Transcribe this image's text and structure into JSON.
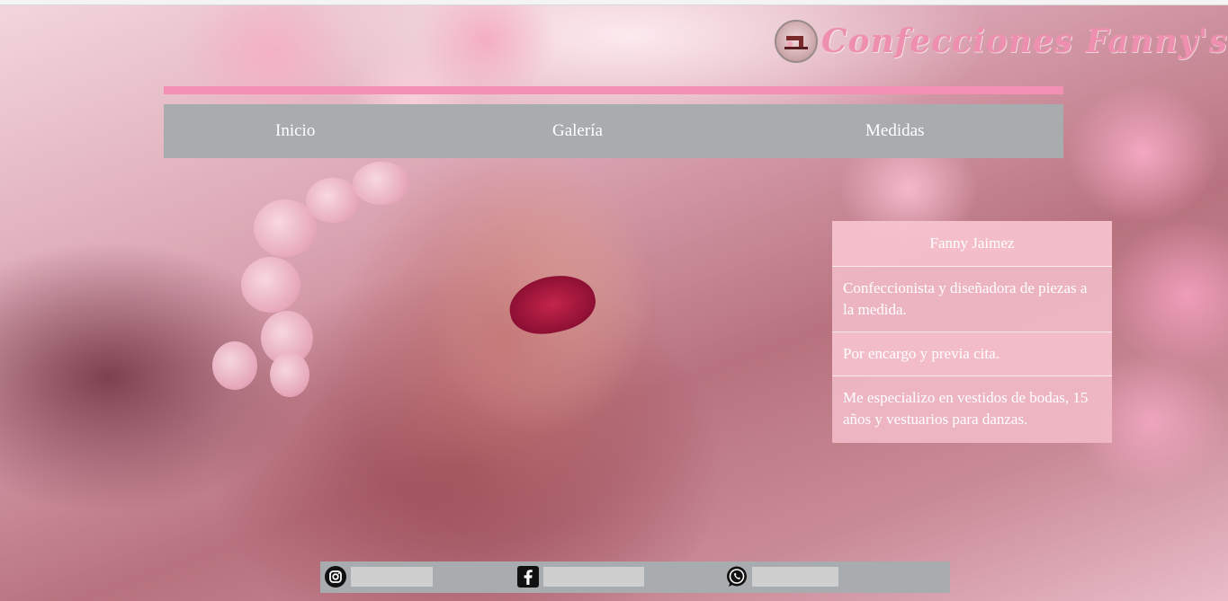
{
  "header": {
    "brand": "Confecciones Fanny's"
  },
  "nav": {
    "items": [
      "Inicio",
      "Galería",
      "Medidas"
    ]
  },
  "panel": {
    "title": "Fanny Jaimez",
    "rows": [
      "Confeccionista y diseñadora de piezas a la medida.",
      "Por encargo y previa cita.",
      "Me especializo en vestidos de bodas, 15 años y vestuarios para danzas."
    ]
  },
  "footer": {
    "links": [
      {
        "icon": "instagram-icon",
        "label": ""
      },
      {
        "icon": "facebook-icon",
        "label": ""
      },
      {
        "icon": "whatsapp-icon",
        "label": ""
      }
    ]
  },
  "colors": {
    "accent_pink": "#f38fb2",
    "nav_gray": "#a8acae",
    "panel_pink": "#f0bac6"
  }
}
